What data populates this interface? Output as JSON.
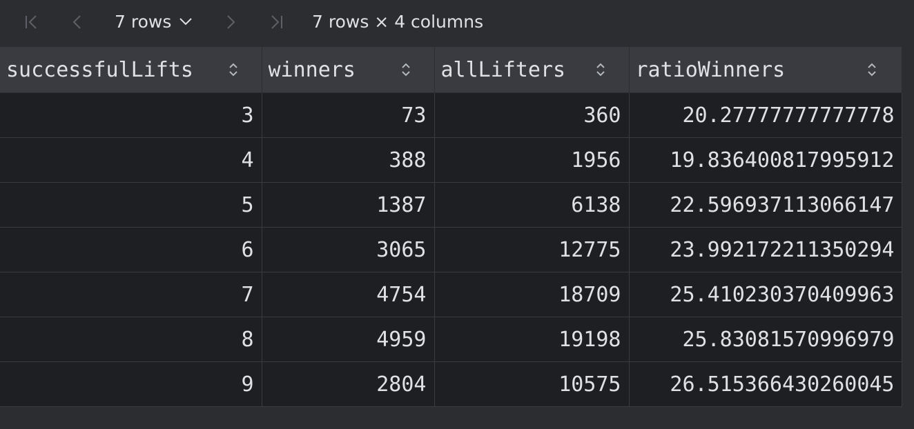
{
  "toolbar": {
    "first_icon": "first-page-icon",
    "prev_icon": "previous-page-icon",
    "rows_label": "7 rows",
    "rows_dropdown_icon": "chevron-down-icon",
    "next_icon": "next-page-icon",
    "last_icon": "last-page-icon",
    "summary": "7 rows × 4 columns"
  },
  "table": {
    "columns": [
      {
        "label": "successfulLifts",
        "sort_icon": "sort-icon"
      },
      {
        "label": "winners",
        "sort_icon": "sort-icon"
      },
      {
        "label": "allLifters",
        "sort_icon": "sort-icon"
      },
      {
        "label": "ratioWinners",
        "sort_icon": "sort-icon"
      }
    ],
    "rows": [
      [
        "3",
        "73",
        "360",
        "20.27777777777778"
      ],
      [
        "4",
        "388",
        "1956",
        "19.836400817995912"
      ],
      [
        "5",
        "1387",
        "6138",
        "22.596937113066147"
      ],
      [
        "6",
        "3065",
        "12775",
        "23.992172211350294"
      ],
      [
        "7",
        "4754",
        "18709",
        "25.410230370409963"
      ],
      [
        "8",
        "4959",
        "19198",
        "25.83081570996979"
      ],
      [
        "9",
        "2804",
        "10575",
        "26.515366430260045"
      ]
    ]
  },
  "colors": {
    "background": "#2b2d30",
    "header_bg": "#393b40",
    "cell_bg": "#1e1f22",
    "text": "#dfe1e5",
    "icon_muted": "#5e6167"
  }
}
